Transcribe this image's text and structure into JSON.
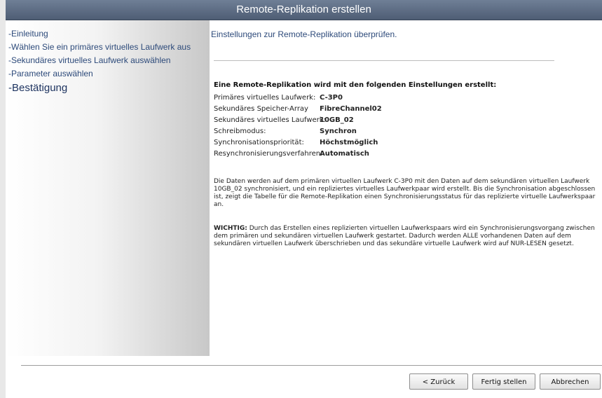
{
  "window": {
    "title": "Remote-Replikation erstellen"
  },
  "sidebar": {
    "steps": [
      {
        "label": "-Einleitung"
      },
      {
        "label": "-Wählen Sie ein primäres virtuelles Laufwerk aus"
      },
      {
        "label": "-Sekundäres virtuelles Laufwerk auswählen"
      },
      {
        "label": "-Parameter auswählen"
      },
      {
        "label": "-Bestätigung"
      }
    ]
  },
  "main": {
    "intro": "Einstellungen zur Remote-Replikation überprüfen.",
    "section_title": "Eine Remote-Replikation wird mit den folgenden Einstellungen erstellt:",
    "settings": [
      {
        "key": "Primäres virtuelles Laufwerk:",
        "value": "C-3P0"
      },
      {
        "key": "Sekundäres Speicher-Array",
        "value": "FibreChannel02"
      },
      {
        "key": "Sekundäres virtuelles Laufwerk:",
        "value": "10GB_02"
      },
      {
        "key": "Schreibmodus:",
        "value": "Synchron"
      },
      {
        "key": "Synchronisationspriorität:",
        "value": "Höchstmöglich"
      },
      {
        "key": "Resynchronisierungsverfahren:",
        "value": "Automatisch"
      }
    ],
    "paragraph1": "Die Daten werden auf dem primären virtuellen Laufwerk C-3P0 mit den Daten auf dem sekundären virtuellen Laufwerk 10GB_02 synchronisiert, und ein repliziertes virtuelles Laufwerkpaar wird erstellt. Bis die Synchronisation abgeschlossen ist, zeigt die Tabelle für die Remote-Replikation einen Synchronisierungsstatus für das replizierte virtuelle Laufwerkspaar an.",
    "important_label": "WICHTIG:",
    "paragraph2": " Durch das Erstellen eines replizierten virtuellen Laufwerkspaars wird ein Synchronisierungsvorgang zwischen dem primären und sekundären virtuellen Laufwerk gestartet. Dadurch werden ALLE vorhandenen Daten auf dem sekundären virtuellen Laufwerk überschrieben und das sekundäre virtuelle Laufwerk wird auf NUR-LESEN gesetzt."
  },
  "footer": {
    "back_label": "< Zurück",
    "finish_label": "Fertig stellen",
    "cancel_label": "Abbrechen"
  }
}
